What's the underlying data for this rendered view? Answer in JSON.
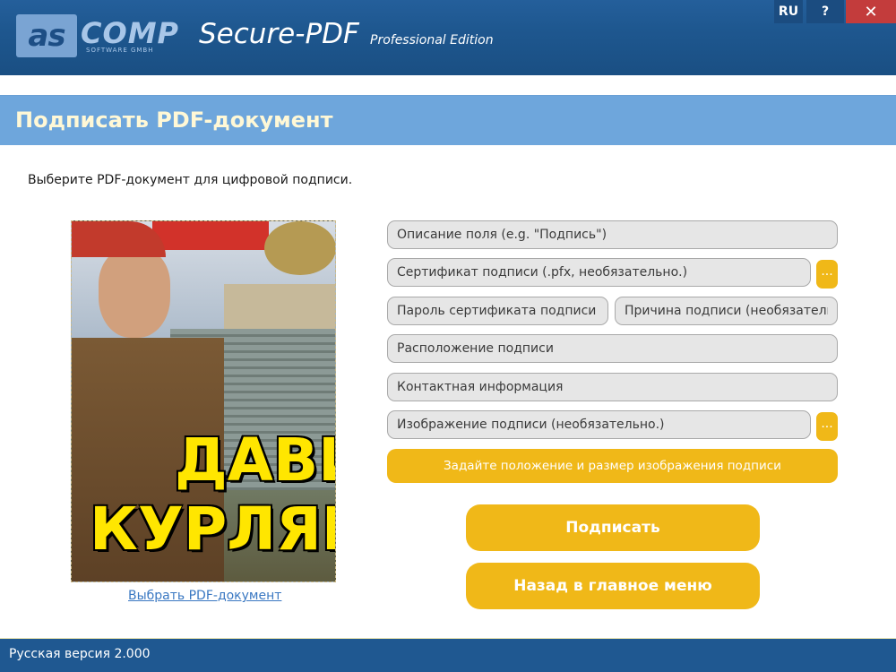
{
  "window": {
    "logo_brand": "ascomp",
    "logo_box_text": "as",
    "logo_text": "COMP",
    "logo_sub": "SOFTWARE GMBH",
    "title": "Secure-PDF",
    "edition": "Professional Edition",
    "lang_label": "RU",
    "help_label": "?",
    "close_label": "✕"
  },
  "section": {
    "title": "Подписать PDF-документ",
    "instruction": "Выберите PDF-документ для цифровой подписи."
  },
  "preview": {
    "cover_line1": "ДАВИ",
    "cover_line2": "КУРЛЯН",
    "choose_link": "Выбрать PDF-документ"
  },
  "form": {
    "field_description": "Описание поля (e.g. \"Подпись\")",
    "certificate": "Сертификат подписи (.pfx, необязательно.)",
    "cert_password": "Пароль сертификата подписи",
    "reason": "Причина подписи (необязательно.)",
    "location": "Расположение подписи",
    "contact": "Контактная информация",
    "signature_image": "Изображение подписи (необязательно.)",
    "browse_label": "...",
    "position_button": "Задайте положение и размер изображения подписи"
  },
  "actions": {
    "sign": "Подписать",
    "back": "Назад в главное меню"
  },
  "status": {
    "version": "Русская версия 2.000"
  },
  "colors": {
    "titlebar": "#1e578f",
    "section_header": "#6ea6dc",
    "accent_button": "#f0b818",
    "statusbar": "#1f5891"
  }
}
